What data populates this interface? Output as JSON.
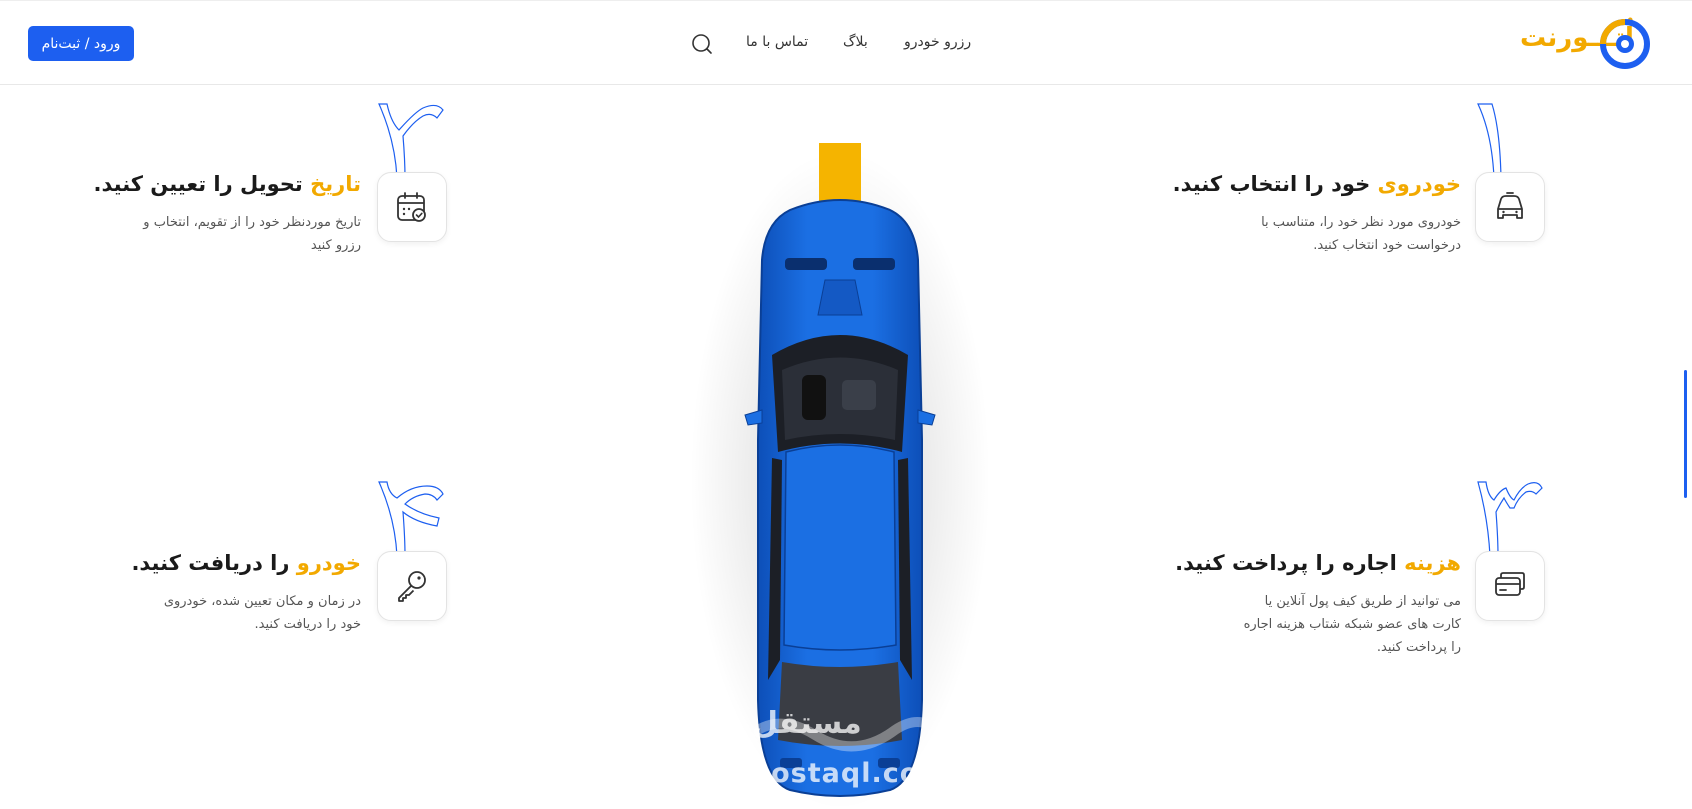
{
  "header": {
    "login_label": "ورود / ثبت‌نام",
    "nav": [
      "رزرو خودرو",
      "بلاگ",
      "تماس با ما"
    ],
    "logo_text": "اُتـــورنت"
  },
  "steps": [
    {
      "number": "۱",
      "title_highlight": "خودروی",
      "title_rest": " خود را انتخاب کنید.",
      "desc_line1": "خودروی مورد نظر خود را، متناسب با",
      "desc_line2": "درخواست خود انتخاب کنید.",
      "desc_line3": "",
      "icon": "car-icon"
    },
    {
      "number": "۲",
      "title_highlight": "تاریخ",
      "title_rest": " تحویل را تعیین کنید.",
      "desc_line1": "تاریخ موردنظر خود را از تقویم، انتخاب و",
      "desc_line2": "رزرو کنید",
      "desc_line3": "",
      "icon": "calendar-icon"
    },
    {
      "number": "۳",
      "title_highlight": "هزینه",
      "title_rest": " اجاره را پرداخت کنید.",
      "desc_line1": "می توانید از طریق کیف پول آنلاین یا",
      "desc_line2": "کارت های عضو شبکه شتاب هزینه اجاره",
      "desc_line3": "را پرداخت کنید.",
      "icon": "card-icon"
    },
    {
      "number": "۴",
      "title_highlight": "خودرو",
      "title_rest": " را دریافت کنید.",
      "desc_line1": "در زمان و مکان تعیین شده، خودروی",
      "desc_line2": "خود را دریافت کنید.",
      "desc_line3": "",
      "icon": "key-icon"
    }
  ],
  "watermark": {
    "arabic": "مستقل",
    "latin": "mostaql.com"
  },
  "colors": {
    "accent": "#1d5ff0",
    "highlight": "#f2a900",
    "car": "#1565d8"
  }
}
